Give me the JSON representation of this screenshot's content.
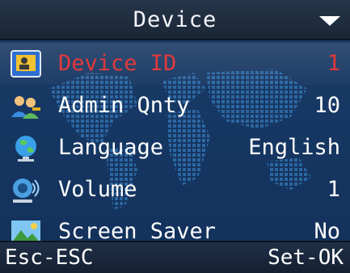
{
  "header": {
    "title": "Device",
    "dropdown_icon": "triangle-down-icon"
  },
  "menu": {
    "items": [
      {
        "label": "Device ID",
        "value": "1",
        "icon": "device-id-icon",
        "selected": true
      },
      {
        "label": "Admin Qnty",
        "value": "10",
        "icon": "admin-users-icon",
        "selected": false
      },
      {
        "label": "Language",
        "value": "English",
        "icon": "globe-icon",
        "selected": false
      },
      {
        "label": "Volume",
        "value": "1",
        "icon": "speaker-volume-icon",
        "selected": false
      },
      {
        "label": "Screen Saver",
        "value": "No",
        "icon": "screen-saver-icon",
        "selected": false
      }
    ]
  },
  "footer": {
    "left_softkey": "Esc-ESC",
    "right_softkey": "Set-OK"
  },
  "colors": {
    "selected_text": "#e23a3a",
    "normal_text": "#ffffff",
    "background": "#173864",
    "bar_background": "#1a2636"
  }
}
